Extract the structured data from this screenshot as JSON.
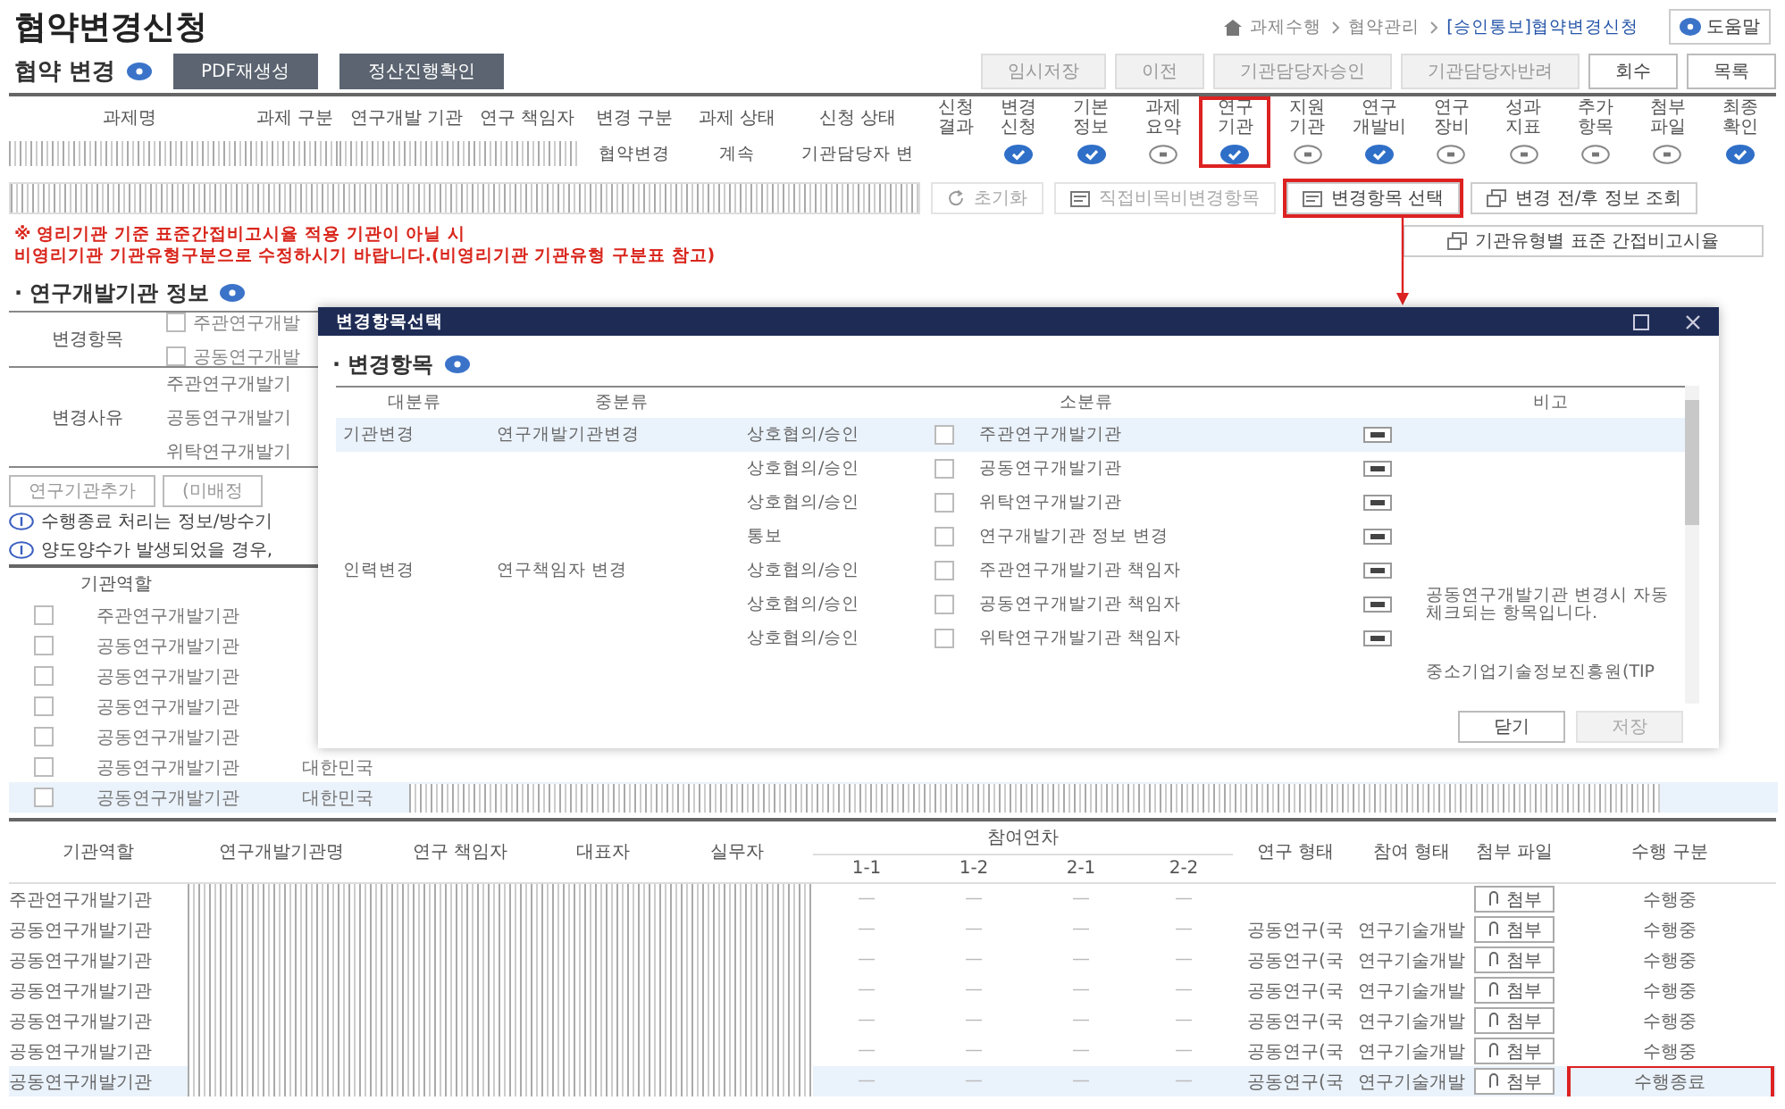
{
  "page": {
    "title": "협약변경신청"
  },
  "breadcrumb": {
    "items": [
      "과제수행",
      "협약관리",
      "[승인통보]협약변경신청"
    ],
    "help": "도움말"
  },
  "agreement": {
    "heading": "협약 변경",
    "buttons": [
      "PDF재생성",
      "정산진행확인"
    ],
    "toolbar": [
      {
        "label": "임시저장",
        "disabled": true
      },
      {
        "label": "이전",
        "disabled": true
      },
      {
        "label": "기관담당자승인",
        "disabled": true
      },
      {
        "label": "기관담당자반려",
        "disabled": true
      },
      {
        "label": "회수",
        "disabled": false
      },
      {
        "label": "목록",
        "disabled": false
      }
    ],
    "columns": [
      "과제명",
      "과제 구분",
      "연구개발 기관",
      "연구 책임자",
      "변경 구분",
      "과제 상태",
      "신청 상태",
      "신청 결과"
    ],
    "row": [
      {
        "kind": "masked"
      },
      {
        "kind": "masked"
      },
      {
        "kind": "masked"
      },
      {
        "kind": "masked"
      },
      {
        "kind": "text",
        "text": "협약변경"
      },
      {
        "kind": "text",
        "text": "계속"
      },
      {
        "kind": "text",
        "text": "기관담당자 변"
      },
      {
        "kind": "empty"
      }
    ],
    "steps": [
      {
        "label": "변경 신청",
        "checked": true,
        "highlighted": false
      },
      {
        "label": "기본 정보",
        "checked": true,
        "highlighted": false
      },
      {
        "label": "과제 요약",
        "checked": false,
        "highlighted": false
      },
      {
        "label": "연구 기관",
        "checked": true,
        "highlighted": true
      },
      {
        "label": "지원 기관",
        "checked": false,
        "highlighted": false
      },
      {
        "label": "연구 개발비",
        "checked": true,
        "highlighted": false
      },
      {
        "label": "연구 장비",
        "checked": false,
        "highlighted": false
      },
      {
        "label": "성과 지표",
        "checked": false,
        "highlighted": false
      },
      {
        "label": "추가 항목",
        "checked": false,
        "highlighted": false
      },
      {
        "label": "첨부 파일",
        "checked": false,
        "highlighted": false
      },
      {
        "label": "최종 확인",
        "checked": true,
        "highlighted": false
      }
    ],
    "actions": [
      {
        "label": "초기화",
        "kind": "refresh",
        "disabled": true,
        "highlighted": false
      },
      {
        "label": "직접비목비변경항목",
        "kind": "form",
        "disabled": true,
        "highlighted": false
      },
      {
        "label": "변경항목 선택",
        "kind": "form",
        "disabled": false,
        "highlighted": true
      },
      {
        "label": "변경 전/후 정보 조회",
        "kind": "copy",
        "disabled": false,
        "highlighted": false
      }
    ],
    "rate_button": "기관유형별 표준 간접비고시율",
    "notice": [
      "※ 영리기관 기준 표준간접비고시율 적용 기관이 아닐 시",
      "비영리기관 기관유형구분으로 수정하시기 바랍니다.(비영리기관 기관유형 구분표 참고)"
    ]
  },
  "org_info": {
    "heading": "· 연구개발기관 정보",
    "change_items": {
      "label": "변경항목",
      "options": [
        {
          "label": "주관연구개발",
          "checked": false
        },
        {
          "label": "공동연구개발",
          "checked": false
        }
      ]
    },
    "change_reasons": {
      "label": "변경사유",
      "rows": [
        "주관연구개발기",
        "공동연구개발기",
        "위탁연구개발기"
      ]
    },
    "buttons": [
      "연구기관추가",
      "(미배정"
    ],
    "notes": [
      "수행종료 처리는 정보/방수기",
      "양도양수가 발생되었을 경우,"
    ],
    "role_header": "기관역할",
    "roles": [
      {
        "role": "주관연구개발기관",
        "masked": false,
        "selected": false
      },
      {
        "role": "공동연구개발기관",
        "masked": false,
        "selected": false
      },
      {
        "role": "공동연구개발기관",
        "masked": false,
        "selected": false
      },
      {
        "role": "공동연구개발기관",
        "masked": false,
        "selected": false
      },
      {
        "role": "공동연구개발기관",
        "masked": false,
        "selected": false
      },
      {
        "role": "공동연구개발기관",
        "country": "대한민국",
        "masked": false,
        "selected": false
      },
      {
        "role": "공동연구개발기관",
        "country": "대한민국",
        "masked": true,
        "selected": true
      }
    ]
  },
  "modal": {
    "title": "변경항목선택",
    "heading": "· 변경항목",
    "columns": [
      "대분류",
      "중분류",
      "소분류",
      "비고"
    ],
    "rows": [
      {
        "major": "기관변경",
        "middle": "연구개발기관변경",
        "type": "상호협의/승인",
        "item": "주관연구개발기관",
        "checked": false,
        "selected": true
      },
      {
        "type": "상호협의/승인",
        "item": "공동연구개발기관",
        "checked": false,
        "selected": false
      },
      {
        "type": "상호협의/승인",
        "item": "위탁연구개발기관",
        "checked": false,
        "selected": false
      },
      {
        "type": "통보",
        "item": "연구개발기관 정보 변경",
        "checked": false,
        "selected": false
      },
      {
        "major": "인력변경",
        "middle": "연구책임자 변경",
        "type": "상호협의/승인",
        "item": "주관연구개발기관 책임자",
        "checked": false,
        "selected": false
      },
      {
        "type": "상호협의/승인",
        "item": "공동연구개발기관 책임자",
        "checked": false,
        "selected": false,
        "remark": "공동연구개발기관 변경시 자동 체크되는 항목입니다."
      },
      {
        "type": "상호협의/승인",
        "item": "위탁연구개발기관 책임자",
        "checked": false,
        "selected": false
      },
      {
        "remark": "중소기업기술정보진흥원(TIP",
        "selected": false
      }
    ],
    "buttons": [
      {
        "label": "닫기",
        "disabled": false
      },
      {
        "label": "저장",
        "disabled": true
      }
    ]
  },
  "participants": {
    "columns": [
      "기관역할",
      "연구개발기관명",
      "연구 책임자",
      "대표자",
      "실무자"
    ],
    "year_header": "참여연차",
    "years": [
      "1-1",
      "1-2",
      "2-1",
      "2-2"
    ],
    "tail_columns": [
      "연구 형태",
      "참여 형태",
      "첨부 파일",
      "수행 구분"
    ],
    "rows": [
      {
        "role": "주관연구개발기관",
        "masked": true,
        "years": [
          "—",
          "—",
          "—",
          "—"
        ],
        "attach": "첨부",
        "status": "수행중",
        "selected": false,
        "highlighted": false
      },
      {
        "role": "공동연구개발기관",
        "masked": true,
        "years": [
          "—",
          "—",
          "—",
          "—"
        ],
        "research_type": "공동연구(국",
        "participation": "연구기술개발",
        "attach": "첨부",
        "status": "수행중",
        "selected": false,
        "highlighted": false
      },
      {
        "role": "공동연구개발기관",
        "masked": true,
        "years": [
          "—",
          "—",
          "—",
          "—"
        ],
        "research_type": "공동연구(국",
        "participation": "연구기술개발",
        "attach": "첨부",
        "status": "수행중",
        "selected": false,
        "highlighted": false
      },
      {
        "role": "공동연구개발기관",
        "masked": true,
        "years": [
          "—",
          "—",
          "—",
          "—"
        ],
        "research_type": "공동연구(국",
        "participation": "연구기술개발",
        "attach": "첨부",
        "status": "수행중",
        "selected": false,
        "highlighted": false
      },
      {
        "role": "공동연구개발기관",
        "masked": true,
        "years": [
          "—",
          "—",
          "—",
          "—"
        ],
        "research_type": "공동연구(국",
        "participation": "연구기술개발",
        "attach": "첨부",
        "status": "수행중",
        "selected": false,
        "highlighted": false
      },
      {
        "role": "공동연구개발기관",
        "masked": true,
        "years": [
          "—",
          "—",
          "—",
          "—"
        ],
        "research_type": "공동연구(국",
        "participation": "연구기술개발",
        "attach": "첨부",
        "status": "수행중",
        "selected": false,
        "highlighted": false
      },
      {
        "role": "공동연구개발기관",
        "masked": true,
        "years": [
          "—",
          "—",
          "—",
          "—"
        ],
        "research_type": "공동연구(국",
        "participation": "연구기술개발",
        "attach": "첨부",
        "status": "수행종료",
        "selected": true,
        "highlighted": true
      }
    ]
  }
}
